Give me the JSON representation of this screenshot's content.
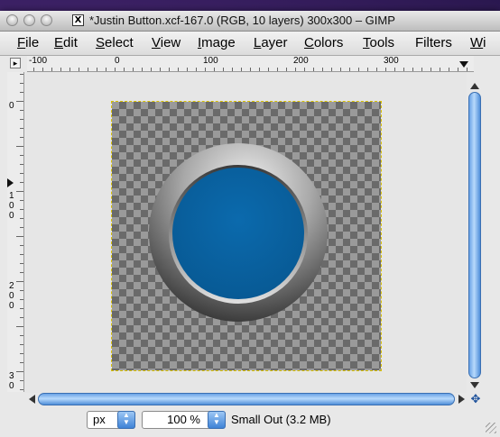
{
  "window": {
    "title": "*Justin Button.xcf-167.0 (RGB, 10 layers) 300x300 – GIMP",
    "x11_glyph": "X"
  },
  "menubar": {
    "items": [
      {
        "key": "F",
        "rest": "ile"
      },
      {
        "key": "E",
        "rest": "dit"
      },
      {
        "key": "S",
        "rest": "elect"
      },
      {
        "key": "V",
        "rest": "iew"
      },
      {
        "key": "I",
        "rest": "mage"
      },
      {
        "key": "L",
        "rest": "ayer"
      },
      {
        "key": "C",
        "rest": "olors"
      },
      {
        "key": "T",
        "rest": "ools"
      },
      {
        "key": "",
        "rest": "Filters"
      },
      {
        "key": "W",
        "rest": "i"
      }
    ]
  },
  "rulers": {
    "corner_glyph": "▸",
    "horizontal_labels": [
      "-100",
      "0",
      "100",
      "200",
      "300"
    ],
    "vertical_labels": [
      "0",
      "1\n0\n0",
      "2\n0\n0",
      "3\n0"
    ]
  },
  "image": {
    "ring_color": "#c8c8c8",
    "fill_color": "#0b6aad",
    "checker_light": "#9a9a9a",
    "checker_dark": "#6a6a6a"
  },
  "scrollbar": {
    "accent": "#4f8ed9",
    "nav_glyph": "✥"
  },
  "statusbar": {
    "unit": "px",
    "zoom": "100 %",
    "status": "Small Out (3.2 MB)"
  }
}
